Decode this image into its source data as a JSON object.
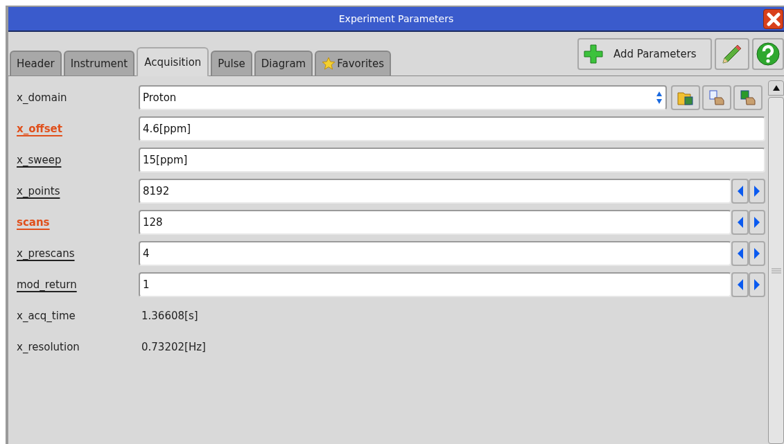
{
  "window": {
    "title": "Experiment Parameters"
  },
  "tabs": [
    {
      "label": "Header",
      "selected": false
    },
    {
      "label": "Instrument",
      "selected": false
    },
    {
      "label": "Acquisition",
      "selected": true
    },
    {
      "label": "Pulse",
      "selected": false
    },
    {
      "label": "Diagram",
      "selected": false
    },
    {
      "label": "Favorites",
      "selected": false,
      "kind": "starred"
    }
  ],
  "toolbar": {
    "add_button": "Add Parameters"
  },
  "parameters": [
    {
      "kind": "select",
      "label": "x_domain",
      "value": "Proton",
      "emphasis": false,
      "underlined": false
    },
    {
      "kind": "text",
      "label": "x_offset",
      "value": "4.6[ppm]",
      "emphasis": true,
      "underlined": true
    },
    {
      "kind": "text",
      "label": "x_sweep",
      "value": "15[ppm]",
      "emphasis": false,
      "underlined": true
    },
    {
      "kind": "spinner",
      "label": "x_points",
      "value": "8192",
      "emphasis": false,
      "underlined": true
    },
    {
      "kind": "spinner",
      "label": "scans",
      "value": "128",
      "emphasis": true,
      "underlined": true
    },
    {
      "kind": "spinner",
      "label": "x_prescans",
      "value": "4",
      "emphasis": false,
      "underlined": true
    },
    {
      "kind": "spinner",
      "label": "mod_return",
      "value": "1",
      "emphasis": false,
      "underlined": true
    },
    {
      "kind": "readout",
      "label": "x_acq_time",
      "value": "1.36608[s]",
      "emphasis": false,
      "underlined": false
    },
    {
      "kind": "readout",
      "label": "x_resolution",
      "value": "0.73202[Hz]",
      "emphasis": false,
      "underlined": false
    }
  ]
}
